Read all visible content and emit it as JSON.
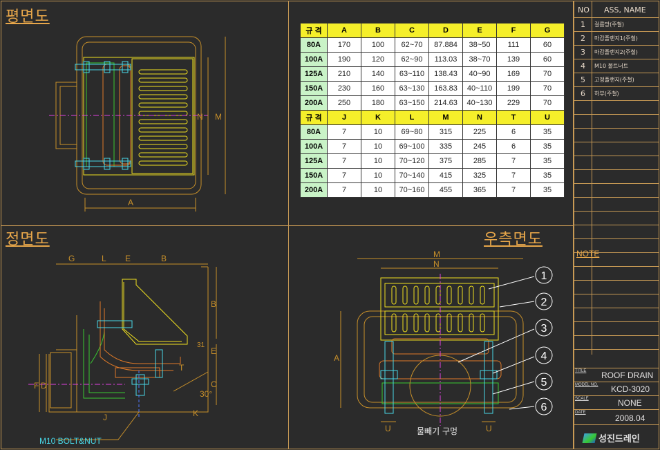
{
  "views": {
    "plan": "평면도",
    "front": "정면도",
    "right_side": "우측면도"
  },
  "plan_dims": {
    "A": "A",
    "N": "N",
    "M": "M"
  },
  "front_dims": {
    "G": "G",
    "L": "L",
    "E": "E",
    "B": "B",
    "T": "T",
    "C": "C",
    "F": "F",
    "D": "D",
    "K": "K",
    "J": "J",
    "angle": "30°",
    "bolt": "M10 BOLT&NUT"
  },
  "side_dims": {
    "M": "M",
    "N": "N",
    "A": "A",
    "U1": "U",
    "U2": "U",
    "drain_hole": "물빼기 구멍"
  },
  "callouts": [
    "1",
    "2",
    "3",
    "4",
    "5",
    "6"
  ],
  "table1": {
    "header": [
      "규 격",
      "A",
      "B",
      "C",
      "D",
      "E",
      "F",
      "G"
    ],
    "rows": [
      [
        "80A",
        "170",
        "100",
        "62~70",
        "87.884",
        "38~50",
        "111",
        "60"
      ],
      [
        "100A",
        "190",
        "120",
        "62~90",
        "113.03",
        "38~70",
        "139",
        "60"
      ],
      [
        "125A",
        "210",
        "140",
        "63~110",
        "138.43",
        "40~90",
        "169",
        "70"
      ],
      [
        "150A",
        "230",
        "160",
        "63~130",
        "163.83",
        "40~110",
        "199",
        "70"
      ],
      [
        "200A",
        "250",
        "180",
        "63~150",
        "214.63",
        "40~130",
        "229",
        "70"
      ]
    ]
  },
  "table2": {
    "header": [
      "규 격",
      "J",
      "K",
      "L",
      "M",
      "N",
      "T",
      "U"
    ],
    "rows": [
      [
        "80A",
        "7",
        "10",
        "69~80",
        "315",
        "225",
        "6",
        "35"
      ],
      [
        "100A",
        "7",
        "10",
        "69~100",
        "335",
        "245",
        "6",
        "35"
      ],
      [
        "125A",
        "7",
        "10",
        "70~120",
        "375",
        "285",
        "7",
        "35"
      ],
      [
        "150A",
        "7",
        "10",
        "70~140",
        "415",
        "325",
        "7",
        "35"
      ],
      [
        "200A",
        "7",
        "10",
        "70~160",
        "455",
        "365",
        "7",
        "35"
      ]
    ]
  },
  "parts_list": {
    "header_no": "NO",
    "header_name": "ASS, NAME",
    "items": [
      {
        "no": "1",
        "name": "걸름망(주철)"
      },
      {
        "no": "2",
        "name": "마감플랜지1(주철)"
      },
      {
        "no": "3",
        "name": "마감플랜지2(주철)"
      },
      {
        "no": "4",
        "name": "M10 볼트너트"
      },
      {
        "no": "5",
        "name": "고정플랜지(주철)"
      },
      {
        "no": "6",
        "name": "하부(주철)"
      }
    ]
  },
  "note_label": "NOTE",
  "title_block": {
    "title_label": "TITLE",
    "title": "ROOF DRAIN",
    "model_label": "MODEL NO.",
    "model": "KCD-3020",
    "scale_label": "SCALE",
    "scale": "NONE",
    "date_label": "DATE",
    "date": "2008.04"
  },
  "company": "성진드레인",
  "colors": {
    "frame": "#c89a55",
    "yellow": "#f0e020",
    "green": "#38c830",
    "orange": "#e07a28",
    "cyan": "#48d8e8",
    "blue": "#5078ff",
    "magenta": "#e040e0",
    "bg": "#2b2b2b"
  }
}
